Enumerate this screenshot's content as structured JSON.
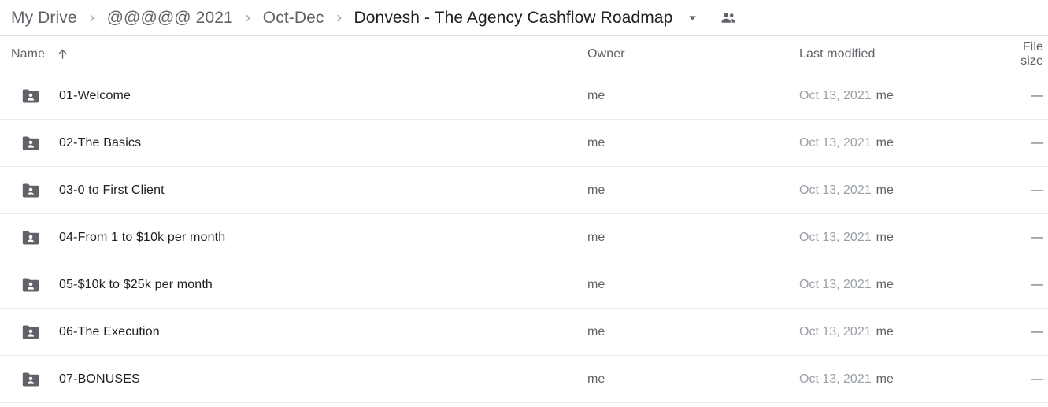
{
  "breadcrumb": {
    "items": [
      {
        "label": "My Drive",
        "current": false
      },
      {
        "label": "@@@@@ 2021",
        "current": false
      },
      {
        "label": "Oct-Dec",
        "current": false
      },
      {
        "label": "Donvesh - The Agency Cashflow Roadmap",
        "current": true
      }
    ],
    "caret_icon": "chevron-down-icon",
    "people_icon": "people-icon",
    "separator_icon": "chevron-right-icon"
  },
  "table": {
    "headers": {
      "name": "Name",
      "owner": "Owner",
      "modified": "Last modified",
      "size": "File size"
    },
    "sort": {
      "column": "Name",
      "direction": "ascending",
      "icon": "arrow-up-icon"
    },
    "rows": [
      {
        "icon": "shared-folder-icon",
        "name": "01-Welcome",
        "owner": "me",
        "modified_date": "Oct 13, 2021",
        "modified_by": "me",
        "size": "—"
      },
      {
        "icon": "shared-folder-icon",
        "name": "02-The Basics",
        "owner": "me",
        "modified_date": "Oct 13, 2021",
        "modified_by": "me",
        "size": "—"
      },
      {
        "icon": "shared-folder-icon",
        "name": "03-0 to First Client",
        "owner": "me",
        "modified_date": "Oct 13, 2021",
        "modified_by": "me",
        "size": "—"
      },
      {
        "icon": "shared-folder-icon",
        "name": "04-From 1 to $10k per month",
        "owner": "me",
        "modified_date": "Oct 13, 2021",
        "modified_by": "me",
        "size": "—"
      },
      {
        "icon": "shared-folder-icon",
        "name": "05-$10k to $25k per month",
        "owner": "me",
        "modified_date": "Oct 13, 2021",
        "modified_by": "me",
        "size": "—"
      },
      {
        "icon": "shared-folder-icon",
        "name": "06-The Execution",
        "owner": "me",
        "modified_date": "Oct 13, 2021",
        "modified_by": "me",
        "size": "—"
      },
      {
        "icon": "shared-folder-icon",
        "name": "07-BONUSES",
        "owner": "me",
        "modified_date": "Oct 13, 2021",
        "modified_by": "me",
        "size": "—"
      }
    ]
  },
  "colors": {
    "folder_icon": "#5f6368",
    "text_primary": "#202124",
    "text_secondary": "#5f6368",
    "text_tertiary": "#9aa0a6",
    "border": "#e8eaed",
    "background": "#ffffff"
  }
}
